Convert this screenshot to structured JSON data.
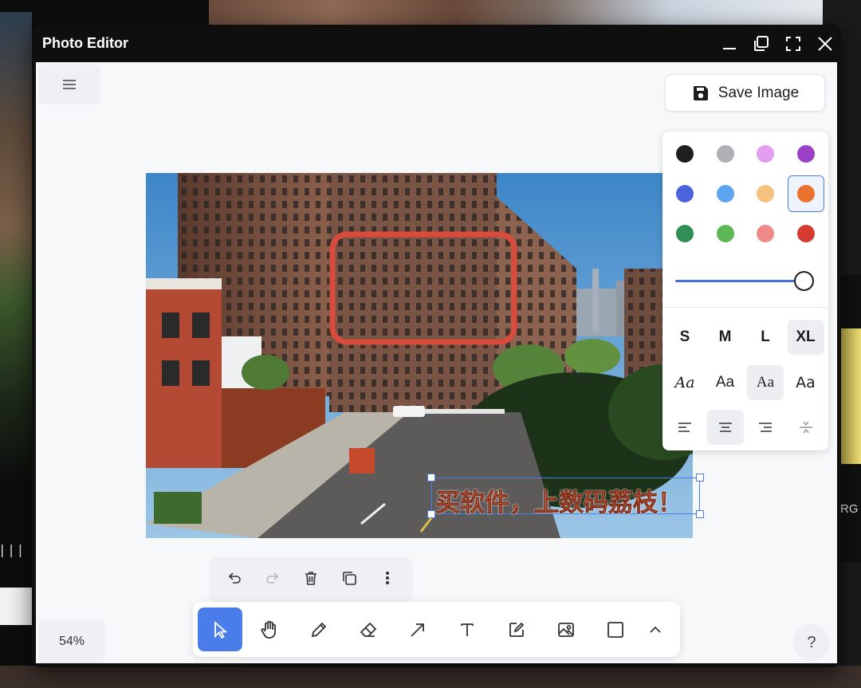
{
  "window": {
    "title": "Photo Editor"
  },
  "header": {
    "save_label": "Save Image"
  },
  "zoom": {
    "level": "54%"
  },
  "help": {
    "label": "?"
  },
  "background": {
    "right_text": "RG"
  },
  "canvas": {
    "text_overlay": "买软件，上数码荔枝！",
    "shape": "rectangle",
    "shape_color": "#d94b3c"
  },
  "style_panel": {
    "colors": [
      "#1f1f1f",
      "#aeb0b5",
      "#e49ef0",
      "#9b40c8",
      "#4a65dc",
      "#5ba4ef",
      "#f6c17c",
      "#ea7330",
      "#2f8f55",
      "#5bb855",
      "#f08a88",
      "#d63b32"
    ],
    "selected_color": "#ea7330",
    "opacity": 1.0,
    "sizes": [
      "S",
      "M",
      "L",
      "XL"
    ],
    "selected_size": "XL",
    "fonts": [
      "Aa",
      "Aa",
      "Aa",
      "Aa"
    ],
    "selected_font": 2,
    "align": [
      "align-left",
      "align-center",
      "align-right",
      "align-vertical"
    ],
    "selected_align": 1
  },
  "edit_toolbar": [
    "undo-icon",
    "redo-icon",
    "trash-icon",
    "duplicate-icon",
    "more-icon"
  ],
  "tools": [
    "select",
    "hand",
    "pencil",
    "eraser",
    "arrow",
    "text",
    "note",
    "image",
    "rectangle",
    "chevron-up"
  ],
  "selected_tool": "select"
}
